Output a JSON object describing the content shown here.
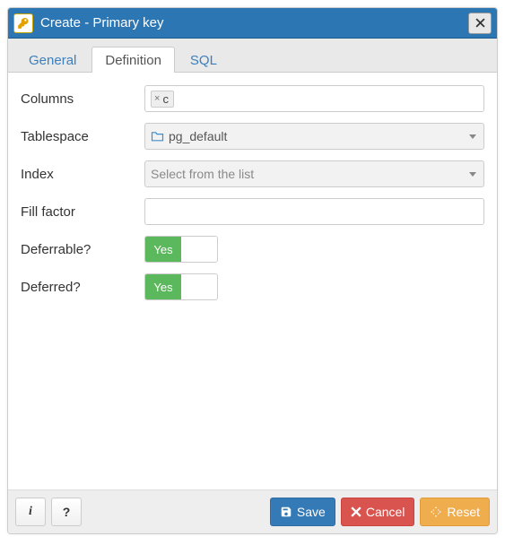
{
  "title": "Create - Primary key",
  "tabs": {
    "general": "General",
    "definition": "Definition",
    "sql": "SQL",
    "active": "definition"
  },
  "fields": {
    "columns": {
      "label": "Columns",
      "tokens": [
        "c"
      ]
    },
    "tablespace": {
      "label": "Tablespace",
      "value": "pg_default"
    },
    "index": {
      "label": "Index",
      "placeholder": "Select from the list",
      "value": ""
    },
    "fill_factor": {
      "label": "Fill factor",
      "value": ""
    },
    "deferrable": {
      "label": "Deferrable?",
      "value": true,
      "on_text": "Yes"
    },
    "deferred": {
      "label": "Deferred?",
      "value": true,
      "on_text": "Yes"
    }
  },
  "footer": {
    "info": "i",
    "help": "?",
    "save": "Save",
    "cancel": "Cancel",
    "reset": "Reset"
  }
}
